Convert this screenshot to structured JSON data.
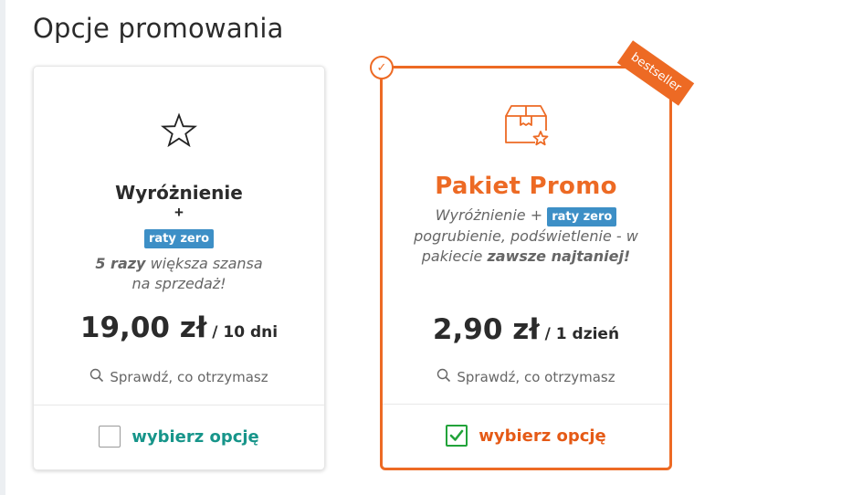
{
  "page": {
    "title": "Opcje promowania"
  },
  "basic": {
    "icon": "star-icon",
    "name": "Wyróżnienie",
    "plus": "+",
    "badge": "raty zero",
    "desc_bold": "5 razy",
    "desc_rest_1": " większa szansa",
    "desc_line2": "na sprzedaż!",
    "price": "19,00 zł",
    "price_period": " / 10 dni",
    "check_label": "Sprawdź, co otrzymasz",
    "select_label": "wybierz opcję",
    "selected": false
  },
  "promo": {
    "icon": "box-star-icon",
    "ribbon": "bestseller",
    "name": "Pakiet Promo",
    "desc_line1_prefix": "Wyróżnienie + ",
    "badge": "raty zero",
    "desc_line2": "pogrubienie, podświetlenie - w",
    "desc_line3_prefix": "pakiecie ",
    "desc_line3_bold": "zawsze najtaniej!",
    "price": "2,90 zł",
    "price_period": " / 1 dzień",
    "check_label": "Sprawdź, co otrzymasz",
    "select_label": "wybierz opcję",
    "selected": true,
    "corner_mark": "✓"
  },
  "colors": {
    "accent_orange": "#ed6a24",
    "badge_blue": "#3d8fc6",
    "teal": "#17958a",
    "check_green": "#22a33a"
  }
}
